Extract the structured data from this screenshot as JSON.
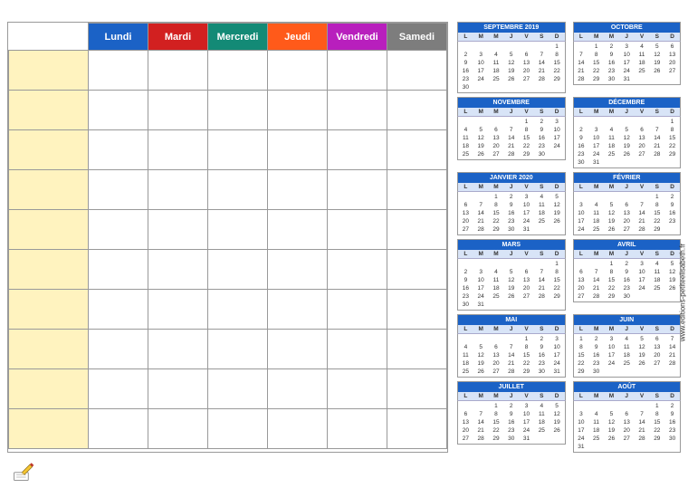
{
  "planner": {
    "days": [
      "Lundi",
      "Mardi",
      "Mercredi",
      "Jeudi",
      "Vendredi",
      "Samedi"
    ],
    "day_colors": [
      "#1b62c6",
      "#d22020",
      "#138a76",
      "#ff5a1a",
      "#b81fbd",
      "#7d7d7d"
    ],
    "row_count": 10
  },
  "dow_labels": [
    "L",
    "M",
    "M",
    "J",
    "V",
    "S",
    "D"
  ],
  "months": [
    {
      "title": "SEPTEMBRE 2019",
      "lead": 6,
      "days": 30
    },
    {
      "title": "OCTOBRE",
      "lead": 1,
      "days": 31
    },
    {
      "title": "NOVEMBRE",
      "lead": 4,
      "days": 30
    },
    {
      "title": "DÉCEMBRE",
      "lead": 6,
      "days": 31
    },
    {
      "title": "JANVIER 2020",
      "lead": 2,
      "days": 31
    },
    {
      "title": "FÉVRIER",
      "lead": 5,
      "days": 29
    },
    {
      "title": "MARS",
      "lead": 6,
      "days": 31
    },
    {
      "title": "AVRIL",
      "lead": 2,
      "days": 30
    },
    {
      "title": "MAI",
      "lead": 4,
      "days": 31
    },
    {
      "title": "JUIN",
      "lead": 0,
      "days": 30
    },
    {
      "title": "JUILLET",
      "lead": 2,
      "days": 31
    },
    {
      "title": "AOÛT",
      "lead": 5,
      "days": 31
    }
  ],
  "watermark": "www.editions-petiteelisabeth.fr"
}
